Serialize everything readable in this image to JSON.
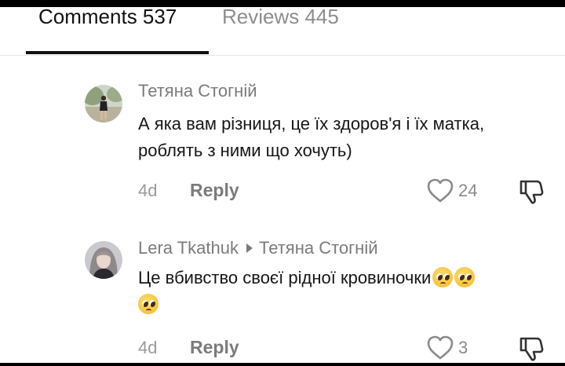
{
  "tabs": [
    {
      "label": "Comments 537",
      "active": true
    },
    {
      "label": "Reviews 445",
      "active": false
    }
  ],
  "comments": [
    {
      "author": "Тетяна Стогній",
      "text": "А яка вам різниця, це їх здоров'я і їх матка, роблять з ними що хочуть)",
      "time": "4d",
      "reply_label": "Reply",
      "likes": "24",
      "icons": {
        "like": "heart-icon",
        "dislike": "thumbs-down-icon"
      }
    },
    {
      "author": "Lera Tkathuk",
      "reply_to": "Тетяна Стогній",
      "text": "Це вбивство своєї рідної кровиночки",
      "emojis": [
        "pleading-face",
        "pleading-face",
        "pleading-face"
      ],
      "time": "4d",
      "reply_label": "Reply",
      "likes": "3",
      "icons": {
        "like": "heart-icon",
        "dislike": "thumbs-down-icon"
      }
    }
  ],
  "colors": {
    "text": "#161616",
    "muted": "#7b7b7b",
    "active_tab": "#111111"
  }
}
